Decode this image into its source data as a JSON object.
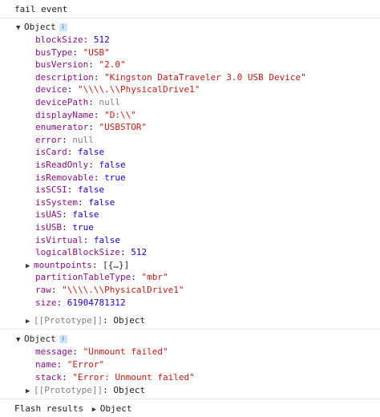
{
  "header": {
    "title": "fail event"
  },
  "object1": {
    "label": "Object",
    "info_glyph": "i",
    "props": [
      {
        "key": "blockSize",
        "value": "512",
        "type": "num"
      },
      {
        "key": "busType",
        "value": "\"USB\"",
        "type": "str"
      },
      {
        "key": "busVersion",
        "value": "\"2.0\"",
        "type": "str"
      },
      {
        "key": "description",
        "value": "\"Kingston DataTraveler 3.0 USB Device\"",
        "type": "str"
      },
      {
        "key": "device",
        "value": "\"\\\\\\\\.\\\\PhysicalDrive1\"",
        "type": "str"
      },
      {
        "key": "devicePath",
        "value": "null",
        "type": "nul"
      },
      {
        "key": "displayName",
        "value": "\"D:\\\\\"",
        "type": "str"
      },
      {
        "key": "enumerator",
        "value": "\"USBSTOR\"",
        "type": "str"
      },
      {
        "key": "error",
        "value": "null",
        "type": "nul"
      },
      {
        "key": "isCard",
        "value": "false",
        "type": "bool"
      },
      {
        "key": "isReadOnly",
        "value": "false",
        "type": "bool"
      },
      {
        "key": "isRemovable",
        "value": "true",
        "type": "bool"
      },
      {
        "key": "isSCSI",
        "value": "false",
        "type": "bool"
      },
      {
        "key": "isSystem",
        "value": "false",
        "type": "bool"
      },
      {
        "key": "isUAS",
        "value": "false",
        "type": "bool"
      },
      {
        "key": "isUSB",
        "value": "true",
        "type": "bool"
      },
      {
        "key": "isVirtual",
        "value": "false",
        "type": "bool"
      },
      {
        "key": "logicalBlockSize",
        "value": "512",
        "type": "num"
      },
      {
        "key": "mountpoints",
        "value": "[{…}]",
        "type": "plain",
        "expandable": true
      },
      {
        "key": "partitionTableType",
        "value": "\"mbr\"",
        "type": "str"
      },
      {
        "key": "raw",
        "value": "\"\\\\\\\\.\\\\PhysicalDrive1\"",
        "type": "str"
      },
      {
        "key": "size",
        "value": "61904781312",
        "type": "num"
      }
    ],
    "prototype": {
      "key": "[[Prototype]]",
      "value": "Object"
    }
  },
  "object2": {
    "label": "Object",
    "info_glyph": "i",
    "props": [
      {
        "key": "message",
        "value": "\"Unmount failed\"",
        "type": "str"
      },
      {
        "key": "name",
        "value": "\"Error\"",
        "type": "str"
      },
      {
        "key": "stack",
        "value": "\"Error: Unmount failed\"",
        "type": "str"
      }
    ],
    "prototype": {
      "key": "[[Prototype]]",
      "value": "Object"
    }
  },
  "footer": {
    "label": "Flash results",
    "object_label": "Object"
  },
  "icons": {
    "expanded": "▼",
    "collapsed": "▶"
  }
}
